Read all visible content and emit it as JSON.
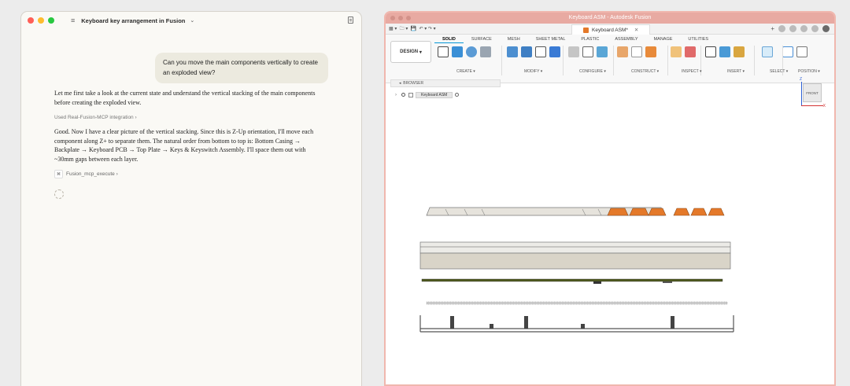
{
  "chat": {
    "window_title": "Keyboard key arrangement in Fusion",
    "user_message": "Can you move the main components vertically to create an exploded view?",
    "assistant_msg1": "Let me first take a look at the current state and understand the vertical stacking of the main components before creating the exploded view.",
    "tool_used": "Used Real-Fusion-MCP integration",
    "assistant_msg2": "Good. Now I have a clear picture of the vertical stacking. Since this is Z-Up orientation, I'll move each component along Z+ to separate them. The natural order from bottom to top is: Bottom Casing → Backplate → Keyboard PCB → Top Plate → Keys & Keyswitch Assembly. I'll space them out with ~30mm gaps between each layer.",
    "tool_call": "Fusion_mcp_execute"
  },
  "fusion": {
    "window_title": "Keyboard ASM - Autodesk Fusion",
    "doc_tab": "Keyboard ASM*",
    "workspace": "DESIGN",
    "ws_tabs": [
      "SOLID",
      "SURFACE",
      "MESH",
      "SHEET METAL",
      "PLASTIC",
      "ASSEMBLY",
      "MANAGE",
      "UTILITIES"
    ],
    "groups": [
      "CREATE",
      "MODIFY",
      "CONFIGURE",
      "CONSTRUCT",
      "INSPECT",
      "INSERT",
      "SELECT",
      "POSITION"
    ],
    "browser_title": "BROWSER",
    "browser_item": "Keyboard ASM",
    "viewcube_face": "FRONT",
    "axis_z": "Z",
    "axis_x": "X",
    "colors": {
      "accent": "#0696d7",
      "keycap_orange": "#e4792a",
      "title_bar": "#e8aaa2"
    }
  }
}
